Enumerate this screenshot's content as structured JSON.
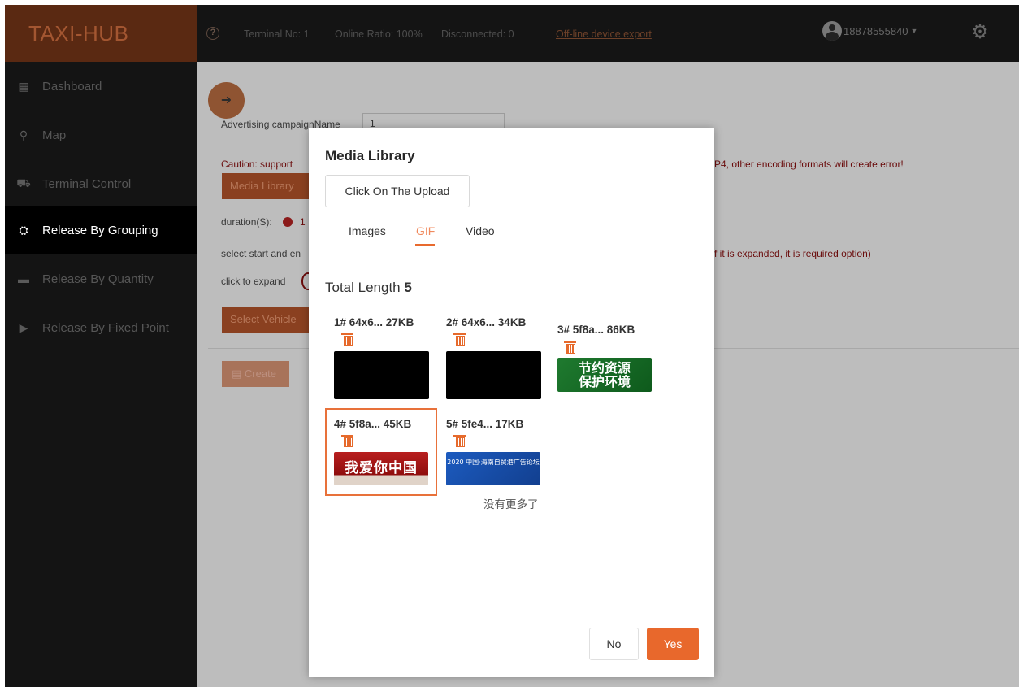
{
  "header": {
    "logo": "TAXI-HUB",
    "terminal_no": "Terminal No:  1",
    "online_ratio": "Online Ratio:  100%",
    "disconnected": "Disconnected:  0",
    "offline_export": "Off-line device export",
    "user": "18878555840"
  },
  "sidebar": {
    "items": [
      {
        "label": "Dashboard",
        "icon": "dashboard-icon"
      },
      {
        "label": "Map",
        "icon": "map-icon"
      },
      {
        "label": "Terminal Control",
        "icon": "car-icon"
      },
      {
        "label": "Release By Grouping",
        "icon": "grouping-icon",
        "active": true
      },
      {
        "label": "Release By Quantity",
        "icon": "quantity-icon"
      },
      {
        "label": "Release By Fixed Point",
        "icon": "play-icon"
      }
    ]
  },
  "background": {
    "campaign_label": "Advertising campaignName",
    "campaign_value": "1",
    "caution_left": "Caution: support",
    "caution_right": "P4, other encoding formats will create error!",
    "media_library_btn": "Media Library",
    "duration_label": "duration(S):",
    "duration_value": "1",
    "select_label": "select start and en",
    "select_right": "f it is expanded, it is required option)",
    "expand_label": "click to expand",
    "select_vehicle_btn": "Select Vehicle",
    "create_btn": "Create"
  },
  "modal": {
    "title": "Media Library",
    "upload_btn": "Click On The Upload",
    "tabs": [
      "Images",
      "GIF",
      "Video"
    ],
    "active_tab": "GIF",
    "total_label": "Total Length",
    "total_value": "5",
    "media": [
      {
        "label": "1# 64x6...  27KB"
      },
      {
        "label": "2# 64x6...  34KB"
      },
      {
        "label": "3# 5f8a...  86KB",
        "thumb_text_1": "节约资源",
        "thumb_text_2": "保护环境"
      },
      {
        "label": "4# 5f8a...  45KB",
        "thumb_text": "我爱你中国",
        "selected": true
      },
      {
        "label": "5# 5fe4...  17KB",
        "thumb_text_1": "2020 中国·海南自贸港广告论坛"
      }
    ],
    "no_more": "没有更多了",
    "no_btn": "No",
    "yes_btn": "Yes"
  },
  "colors": {
    "accent": "#e8682c",
    "sidebar_bg": "#141414",
    "logo_bg": "#5a2912"
  }
}
